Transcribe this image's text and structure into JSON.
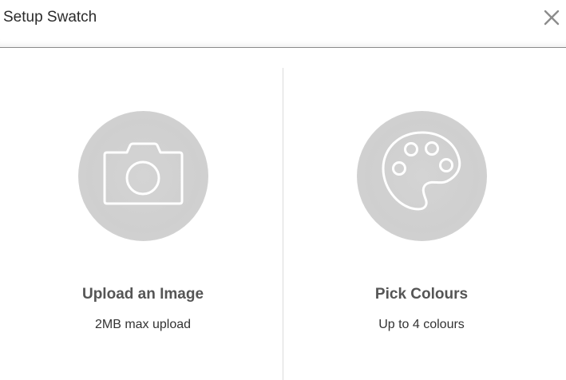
{
  "dialog": {
    "title": "Setup Swatch",
    "close_icon": "close-icon"
  },
  "options": [
    {
      "title": "Upload an Image",
      "subtitle": "2MB max upload",
      "icon": "camera-icon"
    },
    {
      "title": "Pick Colours",
      "subtitle": "Up to 4 colours",
      "icon": "palette-icon"
    }
  ],
  "colors": {
    "circle_fill": "#d1d1d1",
    "icon_stroke": "#ffffff",
    "header_border": "#8a8a8a",
    "divider": "#dcdcdc"
  }
}
